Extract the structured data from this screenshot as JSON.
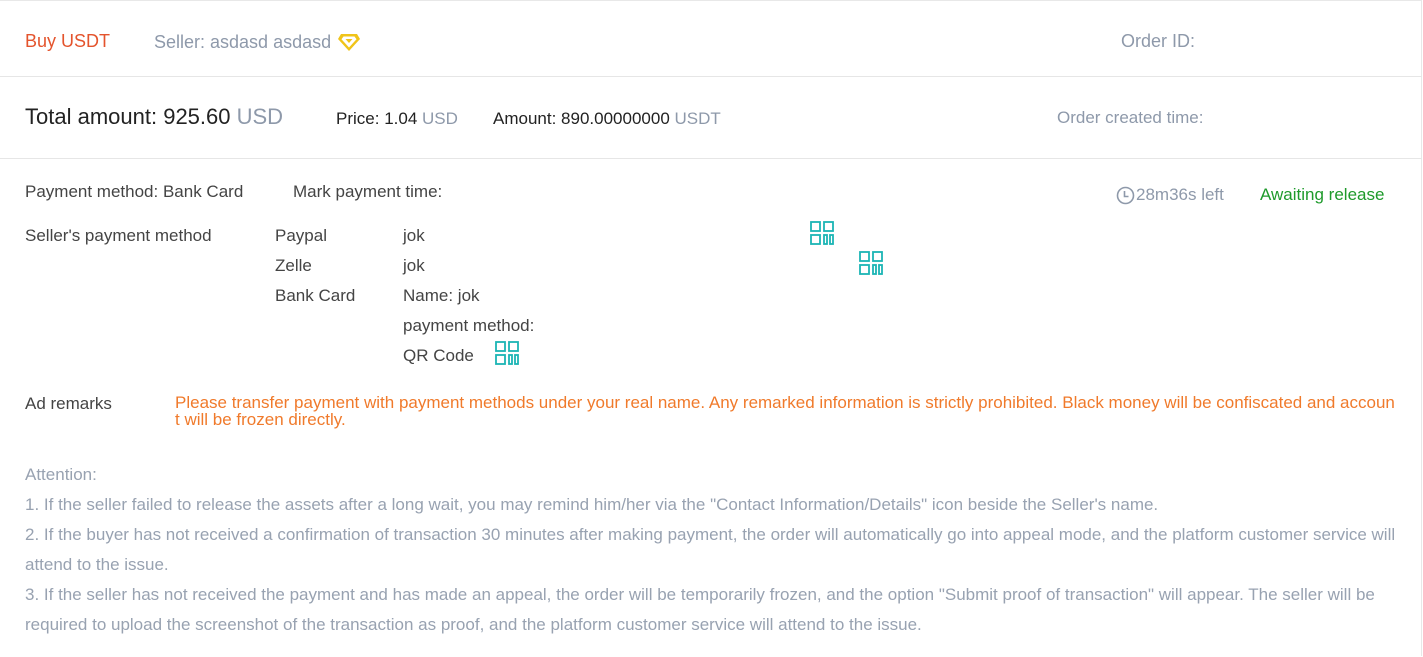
{
  "header": {
    "buy_title": "Buy USDT",
    "seller_label": "Seller: asdasd asdasd",
    "seller_badge_icon": "vip-diamond-icon",
    "order_id_label": "Order ID:"
  },
  "summary": {
    "total_label": "Total amount:",
    "total_value": "925.60",
    "total_unit": "USD",
    "price_label": "Price:",
    "price_value": "1.04",
    "price_unit": "USD",
    "amount_label": "Amount:",
    "amount_value": "890.00000000",
    "amount_unit": "USDT",
    "created_label": "Order created time:"
  },
  "payment": {
    "method_label": "Payment method: Bank Card",
    "mark_time_label": "Mark payment time:",
    "countdown": "28m36s left",
    "status": "Awaiting release",
    "seller_methods_label": "Seller's payment method",
    "methods": [
      {
        "name": "Paypal",
        "value": "jok"
      },
      {
        "name": "Zelle",
        "value": "jok"
      },
      {
        "name": "Bank Card",
        "value": "Name: jok"
      }
    ],
    "bank_extra_line": "payment method:",
    "qr_label": "QR Code"
  },
  "ad": {
    "label": "Ad remarks",
    "text": "Please transfer payment with payment methods under your real name. Any remarked information is strictly prohibited. Black money will be confiscated and account will be frozen directly."
  },
  "attention": {
    "title": "Attention:",
    "items": [
      "1. If the seller failed to release the assets after a long wait, you may remind him/her via the \"Contact Information/Details\"   icon beside the Seller's name.",
      "2. If the buyer has not received a confirmation of transaction 30 minutes after making payment, the order will automatically go into appeal mode, and the platform customer service will attend to the issue.",
      "3. If the seller has not received the payment and has made an appeal, the order will be temporarily frozen, and the option \"Submit proof of transaction\" will appear. The seller will be required to upload the screenshot of the transaction as proof, and the platform customer service will attend to the issue."
    ]
  },
  "colors": {
    "accent": "#e4542d",
    "muted": "#8e99aa",
    "success": "#1e9a2b",
    "warning": "#f07a2b",
    "qr": "#1bb5b5",
    "vip": "#f0c419"
  }
}
